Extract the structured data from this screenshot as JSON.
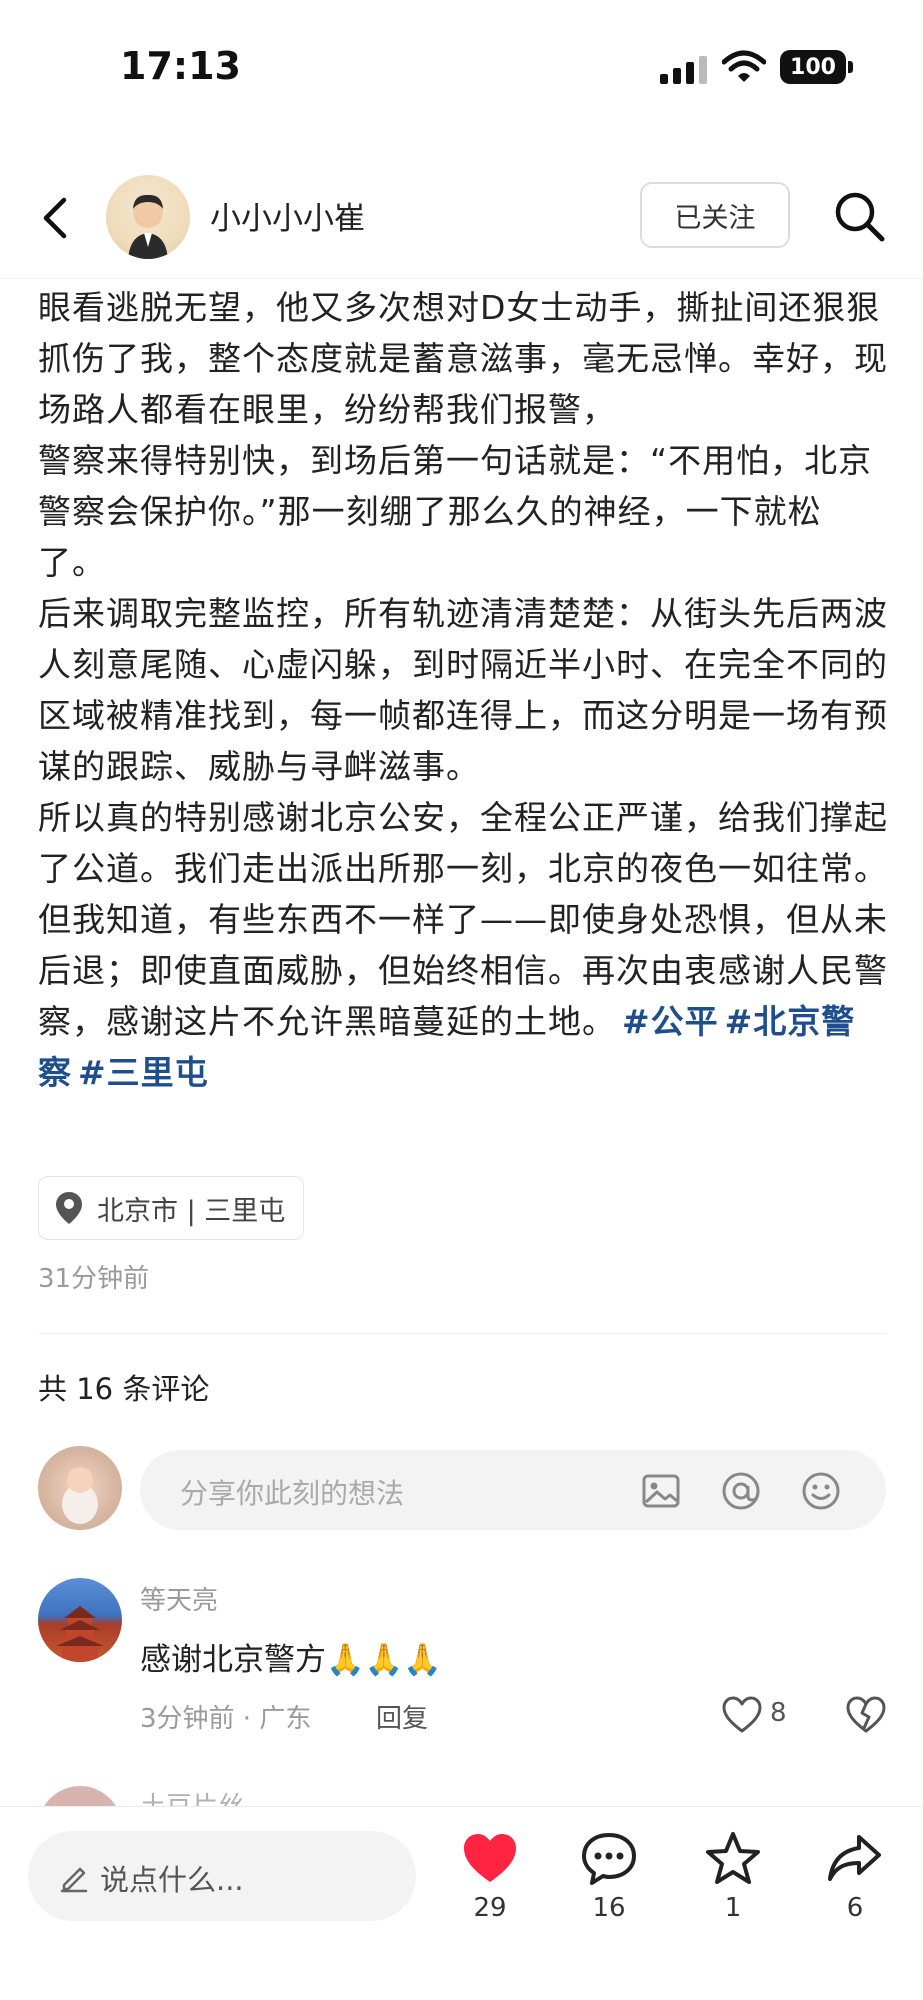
{
  "status_bar": {
    "time": "17:13",
    "battery": "100"
  },
  "header": {
    "author": "小小小小崔",
    "follow_label": "已关注"
  },
  "post": {
    "paragraphs": [
      "眼看逃脱无望，他又多次想对D女士动手，撕扯间还狠狠抓伤了我，整个态度就是蓄意滋事，毫无忌惮。幸好，现场路人都看在眼里，纷纷帮我们报警，",
      "警察来得特别快，到场后第一句话就是：“不用怕，北京警察会保护你。”那一刻绷了那么久的神经，一下就松了。",
      "后来调取完整监控，所有轨迹清清楚楚：从街头先后两波人刻意尾随、心虚闪躲，到时隔近半小时、在完全不同的区域被精准找到，每一帧都连得上，而这分明是一场有预谋的跟踪、威胁与寻衅滋事。",
      "所以真的特别感谢北京公安，全程公正严谨，给我们撑起了公道。我们走出派出所那一刻，北京的夜色一如往常。但我知道，有些东西不一样了——即使身处恐惧，但从未后退；即使直面威胁，但始终相信。再次由衷感谢人民警察，感谢这片不允许黑暗蔓延的土地。"
    ],
    "tags": [
      "#公平",
      "#北京警察",
      "#三里屯"
    ],
    "location": "北京市 | 三里屯",
    "time_ago": "31分钟前"
  },
  "comments": {
    "count_label": "共 16 条评论",
    "input_placeholder": "分享你此刻的想法",
    "items": [
      {
        "user": "等天亮",
        "text": "感谢北京警方🙏🙏🙏",
        "meta": "3分钟前 · 广东",
        "reply_label": "回复",
        "likes": "8"
      }
    ],
    "next_user_partial": "土豆片丝"
  },
  "bottom_bar": {
    "say_placeholder": "说点什么...",
    "likes": "29",
    "comments": "16",
    "favorites": "1",
    "shares": "6",
    "like_color": "#ff2442"
  }
}
